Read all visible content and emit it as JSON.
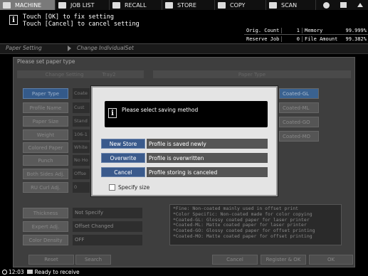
{
  "tabs": [
    {
      "label": "MACHINE",
      "icon": "machine-icon"
    },
    {
      "label": "JOB LIST",
      "icon": "job-list-icon"
    },
    {
      "label": "RECALL",
      "icon": "recall-icon"
    },
    {
      "label": "STORE",
      "icon": "store-icon"
    },
    {
      "label": "COPY",
      "icon": "copy-icon"
    },
    {
      "label": "SCAN",
      "icon": "scan-icon"
    }
  ],
  "header": {
    "message_line1": "Touch [OK] to fix setting",
    "message_line2": "Touch [Cancel] to cancel setting"
  },
  "counters": {
    "orig_count_label": "Orig. Count",
    "orig_count_value": "1",
    "reserve_job_label": "Reserve Job",
    "reserve_job_value": "0",
    "memory_label": "Memory",
    "memory_value": "99.999%",
    "file_amount_label": "File Amount",
    "file_amount_value": "99.382%"
  },
  "breadcrumb": {
    "item1": "Paper Setting",
    "item2": "Change IndividualSet"
  },
  "main": {
    "prompt": "Please set paper type",
    "left_header": "Change Setting",
    "left_header_tray": "Tray2",
    "right_header": "Paper Type",
    "settings": [
      {
        "label": "Paper Type",
        "value": "Coate"
      },
      {
        "label": "Profile Name",
        "value": "Cust"
      },
      {
        "label": "Paper Size",
        "value": "Stand"
      },
      {
        "label": "Weight",
        "value": "106-1"
      },
      {
        "label": "Colored Paper",
        "value": "White"
      },
      {
        "label": "Punch",
        "value": "No Ho"
      },
      {
        "label": "Both Sides Adj.",
        "value": "Offse"
      },
      {
        "label": "RU Curl Adj.",
        "value": "0"
      }
    ],
    "paper_types": [
      "Coated-GL",
      "Coated-ML",
      "Coated-GO",
      "Coated-MO"
    ],
    "bottom_settings": [
      {
        "label": "Thickness",
        "value": "Not Specify"
      },
      {
        "label": "Expert Adj.",
        "value": "Offset Changed"
      },
      {
        "label": "Color Density",
        "value": "OFF"
      }
    ],
    "descriptions": [
      "*Fine: Non-coated mainly used in offset print",
      "*Color Specific: Non-coated made for color copying",
      "*Coated-GL: Glossy coated paper for laser printer",
      "*Coated-ML: Matte coated paper for laser printer",
      "*Coated-GO: Glossy coated paper for offset printing",
      "*Coated-MO: Matte coated paper for offset printing"
    ],
    "footer": {
      "reset": "Reset",
      "search": "Search",
      "cancel": "Cancel",
      "register_ok": "Register & OK",
      "ok": "OK"
    }
  },
  "dialog": {
    "message": "Please select saving method",
    "options": [
      {
        "button": "New Store",
        "description": "Profile is saved newly"
      },
      {
        "button": "Overwrite",
        "description": "Profile is overwritten"
      },
      {
        "button": "Cancel",
        "description": "Profile storing is canceled"
      }
    ],
    "specify_size_label": "Specify size"
  },
  "status": {
    "time": "12:03",
    "message": "Ready to receive"
  }
}
